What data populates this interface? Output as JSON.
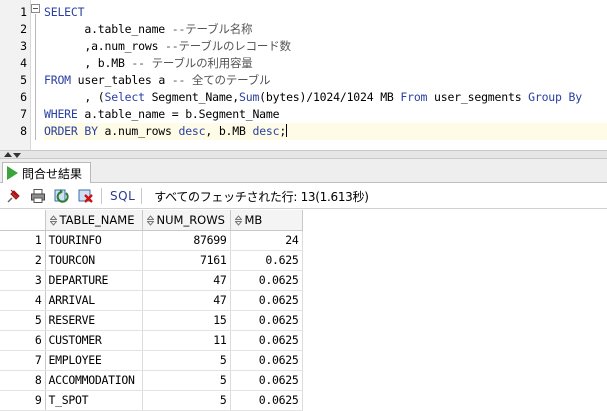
{
  "editor": {
    "line_numbers": [
      "1",
      "2",
      "3",
      "4",
      "5",
      "6",
      "7",
      "8"
    ],
    "lines": [
      [
        {
          "t": "SELECT",
          "c": "kw"
        }
      ],
      [
        {
          "t": "      a.table_name ",
          "c": ""
        },
        {
          "t": "--テーブル名称",
          "c": "cm"
        }
      ],
      [
        {
          "t": "      ,a.num_rows ",
          "c": ""
        },
        {
          "t": "--テーブルのレコード数",
          "c": "cm"
        }
      ],
      [
        {
          "t": "      , b.MB ",
          "c": ""
        },
        {
          "t": "-- テーブルの利用容量",
          "c": "cm"
        }
      ],
      [
        {
          "t": "FROM",
          "c": "kw"
        },
        {
          "t": " user_tables a ",
          "c": ""
        },
        {
          "t": "-- 全てのテーブル",
          "c": "cm"
        }
      ],
      [
        {
          "t": "      , (",
          "c": ""
        },
        {
          "t": "Select",
          "c": "kw"
        },
        {
          "t": " Segment_Name,",
          "c": ""
        },
        {
          "t": "Sum",
          "c": "fn"
        },
        {
          "t": "(bytes)/1024/1024 MB ",
          "c": ""
        },
        {
          "t": "From",
          "c": "kw"
        },
        {
          "t": " user_segments ",
          "c": ""
        },
        {
          "t": "Group By",
          "c": "kw"
        }
      ],
      [
        {
          "t": "WHERE",
          "c": "kw"
        },
        {
          "t": " a.table_name = b.Segment_Name",
          "c": ""
        }
      ],
      [
        {
          "t": "ORDER BY",
          "c": "kw"
        },
        {
          "t": " a.num_rows ",
          "c": ""
        },
        {
          "t": "desc",
          "c": "kw"
        },
        {
          "t": ", b.MB ",
          "c": ""
        },
        {
          "t": "desc",
          "c": "kw"
        },
        {
          "t": ";",
          "c": ""
        }
      ]
    ]
  },
  "results_tab": {
    "label": "問合せ結果"
  },
  "toolbar": {
    "sql_label": "SQL",
    "status": "すべてのフェッチされた行: 13(1.613秒)"
  },
  "grid": {
    "columns": [
      "TABLE_NAME",
      "NUM_ROWS",
      "MB"
    ],
    "rows": [
      {
        "n": "1",
        "name": "TOURINFO",
        "rows": "87699",
        "mb": "24"
      },
      {
        "n": "2",
        "name": "TOURCON",
        "rows": "7161",
        "mb": "0.625"
      },
      {
        "n": "3",
        "name": "DEPARTURE",
        "rows": "47",
        "mb": "0.0625"
      },
      {
        "n": "4",
        "name": "ARRIVAL",
        "rows": "47",
        "mb": "0.0625"
      },
      {
        "n": "5",
        "name": "RESERVE",
        "rows": "15",
        "mb": "0.0625"
      },
      {
        "n": "6",
        "name": "CUSTOMER",
        "rows": "11",
        "mb": "0.0625"
      },
      {
        "n": "7",
        "name": "EMPLOYEE",
        "rows": "5",
        "mb": "0.0625"
      },
      {
        "n": "8",
        "name": "ACCOMMODATION",
        "rows": "5",
        "mb": "0.0625"
      },
      {
        "n": "9",
        "name": "T_SPOT",
        "rows": "5",
        "mb": "0.0625"
      }
    ]
  },
  "colors": {
    "keyword": "#2a3fa3",
    "run_icon": "#3aa53a",
    "current_line": "#fefbe6"
  },
  "icons": [
    "fold-toggle-icon",
    "collapse-up-icon",
    "collapse-down-icon",
    "run-icon",
    "pin-icon",
    "print-icon",
    "refresh-icon",
    "delete-icon"
  ]
}
